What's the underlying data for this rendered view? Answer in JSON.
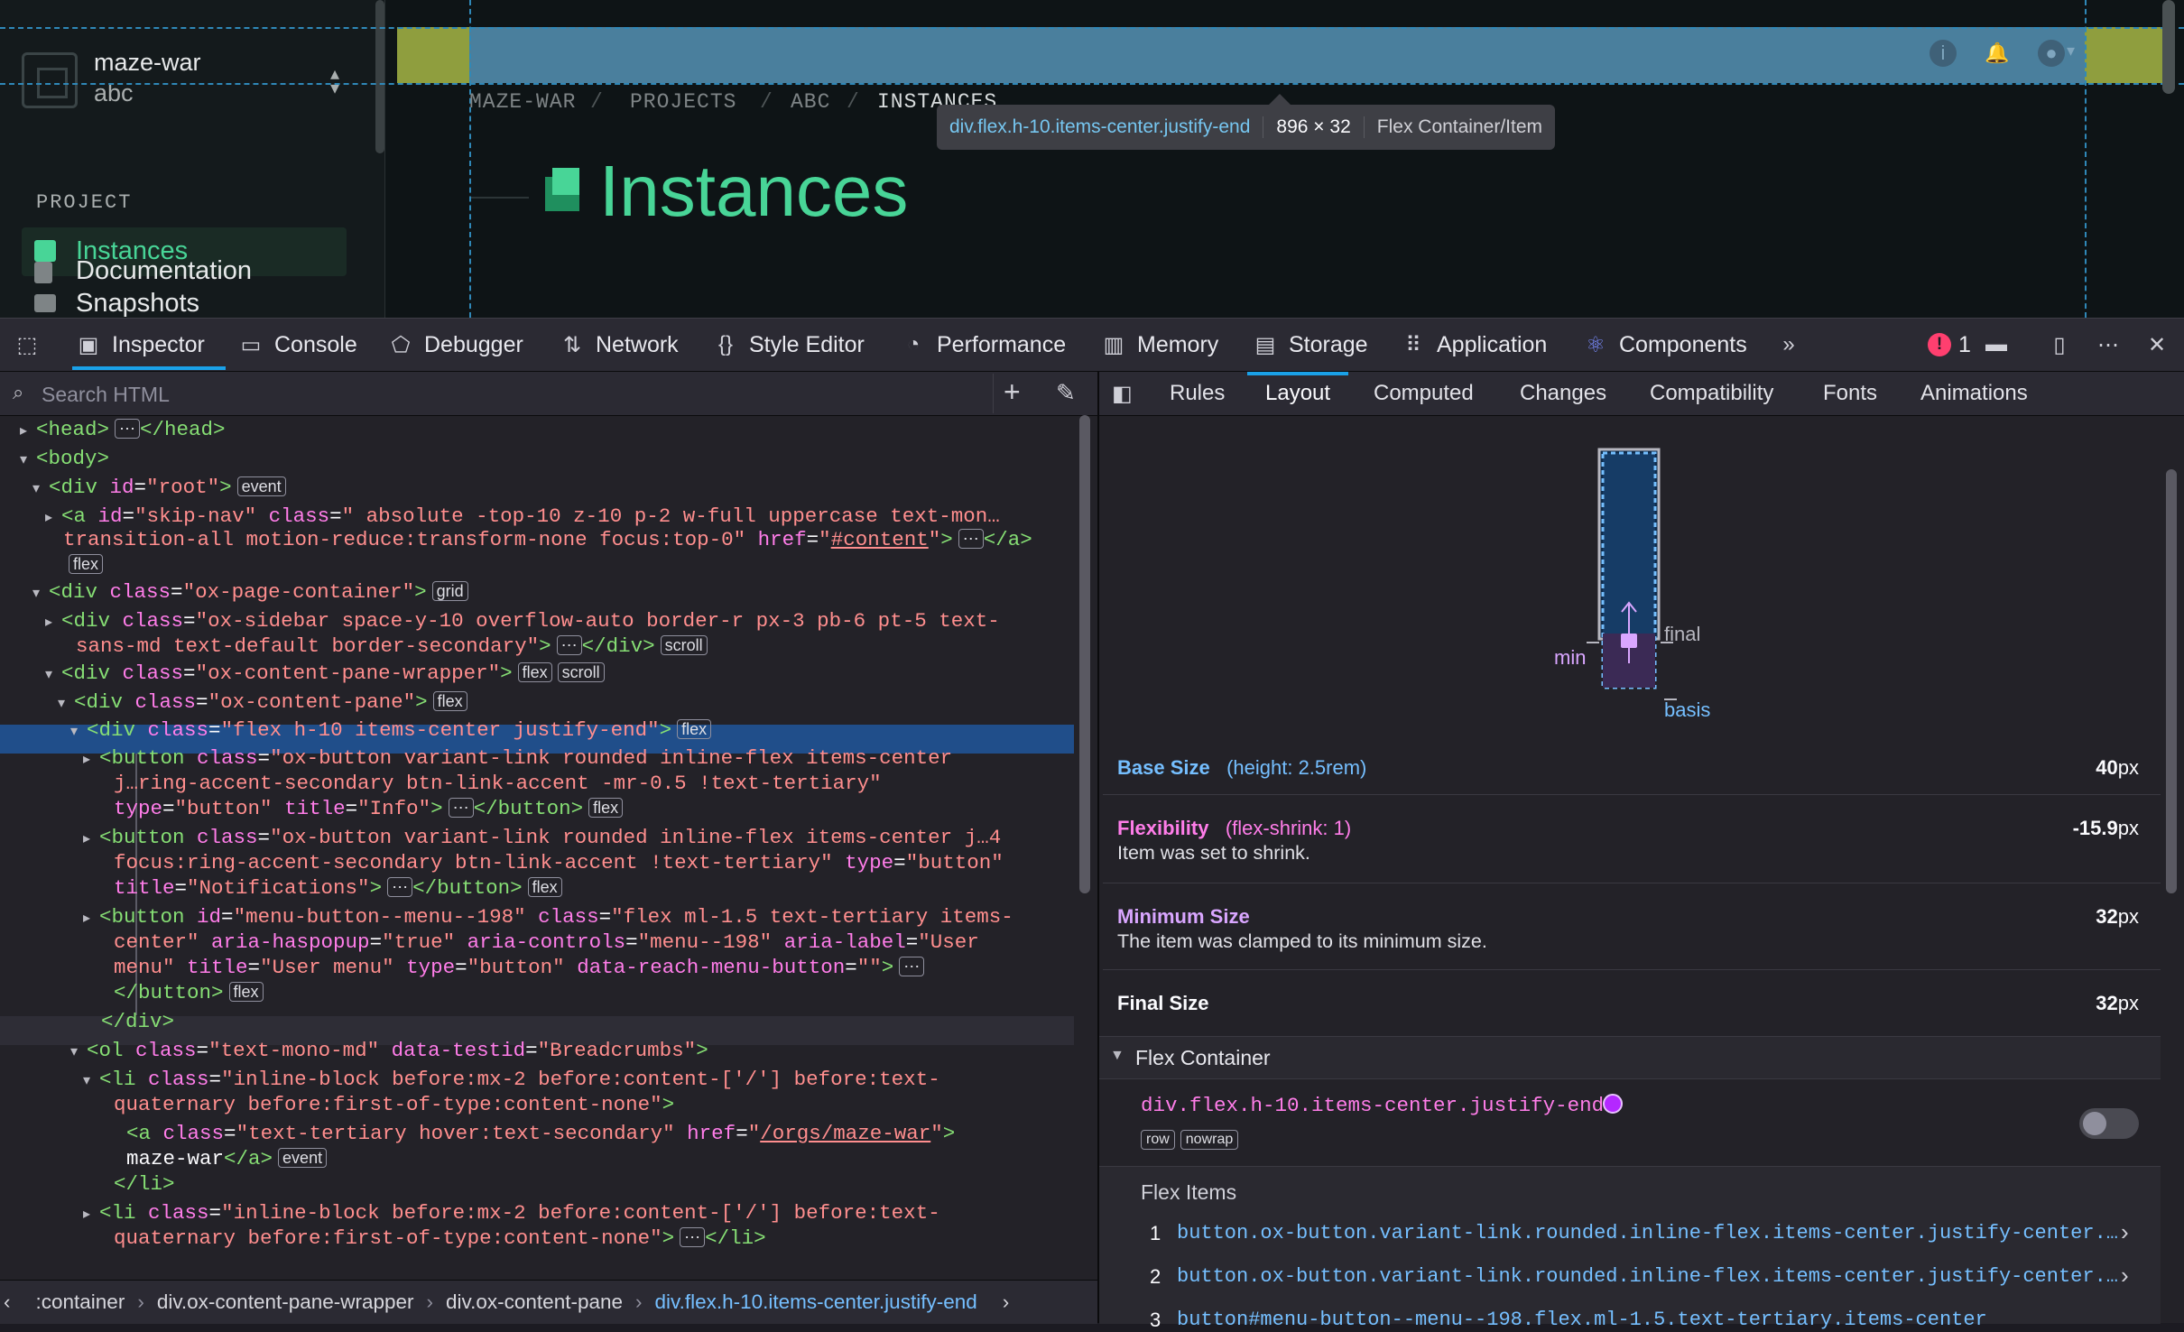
{
  "preview": {
    "project_name": "maze-war",
    "project_sub": "abc",
    "section_label": "PROJECT",
    "nav": [
      "Instances",
      "Documentation",
      "Snapshots"
    ],
    "breadcrumbs": [
      "MAZE-WAR",
      "PROJECTS",
      "ABC",
      "INSTANCES"
    ],
    "crumb_sep": "/",
    "page_title": "Instances",
    "tooltip": {
      "selector": "div.flex.h-10.items-center.justify-end",
      "size": "896 × 32",
      "kind": "Flex Container/Item"
    }
  },
  "toolbar": {
    "tabs": [
      "Inspector",
      "Console",
      "Debugger",
      "Network",
      "Style Editor",
      "Performance",
      "Memory",
      "Storage",
      "Application",
      "Components"
    ],
    "error_count": "1"
  },
  "markup": {
    "search_placeholder": "Search HTML",
    "lines": [
      {
        "indent": 1,
        "tw": "▸",
        "html": "<span class=\"tag\">&lt;head&gt;</span><span class=\"badge\">⋯</span><span class=\"tag\">&lt;/head&gt;</span>"
      },
      {
        "indent": 1,
        "tw": "▾",
        "html": "<span class=\"tag\">&lt;body&gt;</span>"
      },
      {
        "indent": 2,
        "tw": "▾",
        "html": "<span class=\"tag\">&lt;div</span> <span class=\"an\">id</span>=<span class=\"av\">\"root\"</span><span class=\"tag\">&gt;</span><span class=\"badge\">event</span>"
      },
      {
        "indent": 3,
        "tw": "▸",
        "html": "<span class=\"tag\">&lt;a</span> <span class=\"an\">id</span>=<span class=\"av\">\"skip-nav\"</span> <span class=\"an\">class</span>=<span class=\"av\">\" absolute -top-10 z-10 p-2 w-full uppercase text-mon…</span>"
      },
      {
        "indent": 3,
        "tw": "",
        "html": "<span class=\"av\">transition-all motion-reduce:transform-none focus:top-0\"</span> <span class=\"an\">href</span>=<span class=\"av\">\"<u>#content</u>\"</span><span class=\"tag\">&gt;</span><span class=\"badge\">⋯</span><span class=\"tag\">&lt;/a&gt;</span>"
      },
      {
        "indent": 3,
        "tw": "",
        "html": "<span class=\"badge\">flex</span>"
      },
      {
        "indent": 2,
        "tw": "▾",
        "html": "<span class=\"tag\">&lt;div</span> <span class=\"an\">class</span>=<span class=\"av\">\"ox-page-container\"</span><span class=\"tag\">&gt;</span><span class=\"badge\">grid</span>"
      },
      {
        "indent": 3,
        "tw": "▸",
        "html": "<span class=\"tag\">&lt;div</span> <span class=\"an\">class</span>=<span class=\"av\">\"ox-sidebar space-y-10 overflow-auto border-r px-3 pb-6 pt-5 text-</span>"
      },
      {
        "indent": 4,
        "tw": "",
        "html": "<span class=\"av\">sans-md text-default border-secondary\"</span><span class=\"tag\">&gt;</span><span class=\"badge\">⋯</span><span class=\"tag\">&lt;/div&gt;</span><span class=\"badge\">scroll</span>"
      },
      {
        "indent": 3,
        "tw": "▾",
        "html": "<span class=\"tag\">&lt;div</span> <span class=\"an\">class</span>=<span class=\"av\">\"ox-content-pane-wrapper\"</span><span class=\"tag\">&gt;</span><span class=\"badge\">flex</span><span class=\"badge\">scroll</span>"
      },
      {
        "indent": 4,
        "tw": "▾",
        "html": "<span class=\"tag\">&lt;div</span> <span class=\"an\">class</span>=<span class=\"av\">\"ox-content-pane\"</span><span class=\"tag\">&gt;</span><span class=\"badge\">flex</span>"
      },
      {
        "indent": 5,
        "tw": "▾",
        "html": "<span class=\"tag\">&lt;div</span> <span class=\"an\">class</span>=<span class=\"av\">\"flex h-10 items-center justify-end\"</span><span class=\"tag\">&gt;</span><span class=\"badge\">flex</span>"
      },
      {
        "indent": 6,
        "tw": "▸",
        "html": "<span class=\"tag\">&lt;button</span> <span class=\"an\">class</span>=<span class=\"av\">\"ox-button variant-link rounded inline-flex items-center</span>"
      },
      {
        "indent": 7,
        "tw": "",
        "html": "<span class=\"av\">j…ring-accent-secondary btn-link-accent -mr-0.5 !text-tertiary\"</span>"
      },
      {
        "indent": 7,
        "tw": "",
        "html": "<span class=\"an\">type</span>=<span class=\"av\">\"button\"</span> <span class=\"an\">title</span>=<span class=\"av\">\"Info\"</span><span class=\"tag\">&gt;</span><span class=\"badge\">⋯</span><span class=\"tag\">&lt;/button&gt;</span><span class=\"badge\">flex</span>"
      },
      {
        "indent": 6,
        "tw": "▸",
        "html": "<span class=\"tag\">&lt;button</span> <span class=\"an\">class</span>=<span class=\"av\">\"ox-button variant-link rounded inline-flex items-center j…4</span>"
      },
      {
        "indent": 7,
        "tw": "",
        "html": "<span class=\"av\">focus:ring-accent-secondary btn-link-accent !text-tertiary\"</span> <span class=\"an\">type</span>=<span class=\"av\">\"button\"</span>"
      },
      {
        "indent": 7,
        "tw": "",
        "html": "<span class=\"an\">title</span>=<span class=\"av\">\"Notifications\"</span><span class=\"tag\">&gt;</span><span class=\"badge\">⋯</span><span class=\"tag\">&lt;/button&gt;</span><span class=\"badge\">flex</span>"
      },
      {
        "indent": 6,
        "tw": "▸",
        "html": "<span class=\"tag\">&lt;button</span> <span class=\"an\">id</span>=<span class=\"av\">\"menu-button--menu--198\"</span> <span class=\"an\">class</span>=<span class=\"av\">\"flex ml-1.5 text-tertiary items-</span>"
      },
      {
        "indent": 7,
        "tw": "",
        "html": "<span class=\"av\">center\"</span> <span class=\"an\">aria-haspopup</span>=<span class=\"av\">\"true\"</span> <span class=\"an\">aria-controls</span>=<span class=\"av\">\"menu--198\"</span> <span class=\"an\">aria-label</span>=<span class=\"av\">\"User</span>"
      },
      {
        "indent": 7,
        "tw": "",
        "html": "<span class=\"av\">menu\"</span> <span class=\"an\">title</span>=<span class=\"av\">\"User menu\"</span> <span class=\"an\">type</span>=<span class=\"av\">\"button\"</span> <span class=\"an\">data-reach-menu-button</span>=<span class=\"av\">\"\"</span><span class=\"tag\">&gt;</span><span class=\"badge\">⋯</span>"
      },
      {
        "indent": 7,
        "tw": "",
        "html": "<span class=\"tag\">&lt;/button&gt;</span><span class=\"badge\">flex</span>"
      },
      {
        "indent": 6,
        "tw": "",
        "html": "<span class=\"tag\">&lt;/div&gt;</span>"
      },
      {
        "indent": 5,
        "tw": "▾",
        "html": "<span class=\"tag\">&lt;ol</span> <span class=\"an\">class</span>=<span class=\"av\">\"text-mono-md\"</span> <span class=\"an\">data-testid</span>=<span class=\"av\">\"Breadcrumbs\"</span><span class=\"tag\">&gt;</span>"
      },
      {
        "indent": 6,
        "tw": "▾",
        "html": "<span class=\"tag\">&lt;li</span> <span class=\"an\">class</span>=<span class=\"av\">\"inline-block before:mx-2 before:content-['/'] before:text-</span>"
      },
      {
        "indent": 7,
        "tw": "",
        "html": "<span class=\"av\">quaternary before:first-of-type:content-none\"</span><span class=\"tag\">&gt;</span>"
      },
      {
        "indent": 8,
        "tw": "",
        "html": "<span class=\"tag\">&lt;a</span> <span class=\"an\">class</span>=<span class=\"av\">\"text-tertiary hover:text-secondary\"</span> <span class=\"an\">href</span>=<span class=\"av\">\"<u>/orgs/maze-war</u>\"</span><span class=\"tag\">&gt;</span>"
      },
      {
        "indent": 8,
        "tw": "",
        "html": "<span class=\"pl\">maze-war</span><span class=\"tag\">&lt;/a&gt;</span><span class=\"badge\">event</span>"
      },
      {
        "indent": 7,
        "tw": "",
        "html": "<span class=\"tag\">&lt;/li&gt;</span>"
      },
      {
        "indent": 6,
        "tw": "▸",
        "html": "<span class=\"tag\">&lt;li</span> <span class=\"an\">class</span>=<span class=\"av\">\"inline-block before:mx-2 before:content-['/'] before:text-</span>"
      },
      {
        "indent": 7,
        "tw": "",
        "html": "<span class=\"av\">quaternary before:first-of-type:content-none\"</span><span class=\"tag\">&gt;</span><span class=\"badge\">⋯</span><span class=\"tag\">&lt;/li&gt;</span>"
      }
    ],
    "node_breadcrumbs": [
      ":container",
      "div.ox-content-pane-wrapper",
      "div.ox-content-pane",
      "div.flex.h-10.items-center.justify-end"
    ]
  },
  "sidebar": {
    "tabs": [
      "Rules",
      "Layout",
      "Computed",
      "Changes",
      "Compatibility",
      "Fonts",
      "Animations"
    ],
    "active_tab": "Layout",
    "diagram": {
      "final": "final",
      "min": "min",
      "basis": "basis"
    },
    "rows": [
      {
        "title": "Base Size",
        "note": "(height: 2.5rem)",
        "value": "40",
        "unit": "px",
        "sub": ""
      },
      {
        "title": "Flexibility",
        "note": "(flex-shrink: 1)",
        "value": "-15.9",
        "unit": "px",
        "sub": "Item was set to shrink."
      },
      {
        "title": "Minimum Size",
        "note": "",
        "value": "32",
        "unit": "px",
        "sub": "The item was clamped to its minimum size."
      },
      {
        "title": "Final Size",
        "note": "",
        "value": "32",
        "unit": "px",
        "sub": ""
      }
    ],
    "flex_container": {
      "header": "Flex Container",
      "selector": "div.flex.h-10.items-center.justify-end",
      "badges": [
        "row",
        "nowrap"
      ],
      "items_label": "Flex Items",
      "items": [
        "button.ox-button.variant-link.rounded.inline-flex.items-center.justify-center.…",
        "button.ox-button.variant-link.rounded.inline-flex.items-center.justify-center.…",
        "button#menu-button--menu--198.flex.ml-1.5.text-tertiary.items-center"
      ]
    },
    "colors": {
      "base": "#75bfff",
      "flex": "#ff7de9",
      "accent": "#1aa1e8"
    }
  }
}
